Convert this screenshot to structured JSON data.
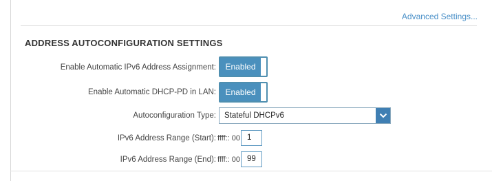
{
  "header": {
    "advanced_link": "Advanced Settings..."
  },
  "section": {
    "title": "ADDRESS AUTOCONFIGURATION SETTINGS"
  },
  "rows": {
    "auto_ipv6": {
      "label": "Enable Automatic IPv6 Address Assignment:",
      "value": "Enabled"
    },
    "dhcp_pd": {
      "label": "Enable Automatic DHCP-PD in LAN:",
      "value": "Enabled"
    },
    "autoconf_type": {
      "label": "Autoconfiguration Type:",
      "selected": "Stateful DHCPv6"
    },
    "range_start": {
      "label": "IPv6 Address Range (Start):",
      "prefix": "ffff:: 00",
      "value": "1"
    },
    "range_end": {
      "label": "IPv6 Address Range (End):",
      "prefix": "ffff:: 00",
      "value": "99"
    }
  },
  "colors": {
    "accent": "#4a90bd",
    "link": "#4a90c8"
  }
}
